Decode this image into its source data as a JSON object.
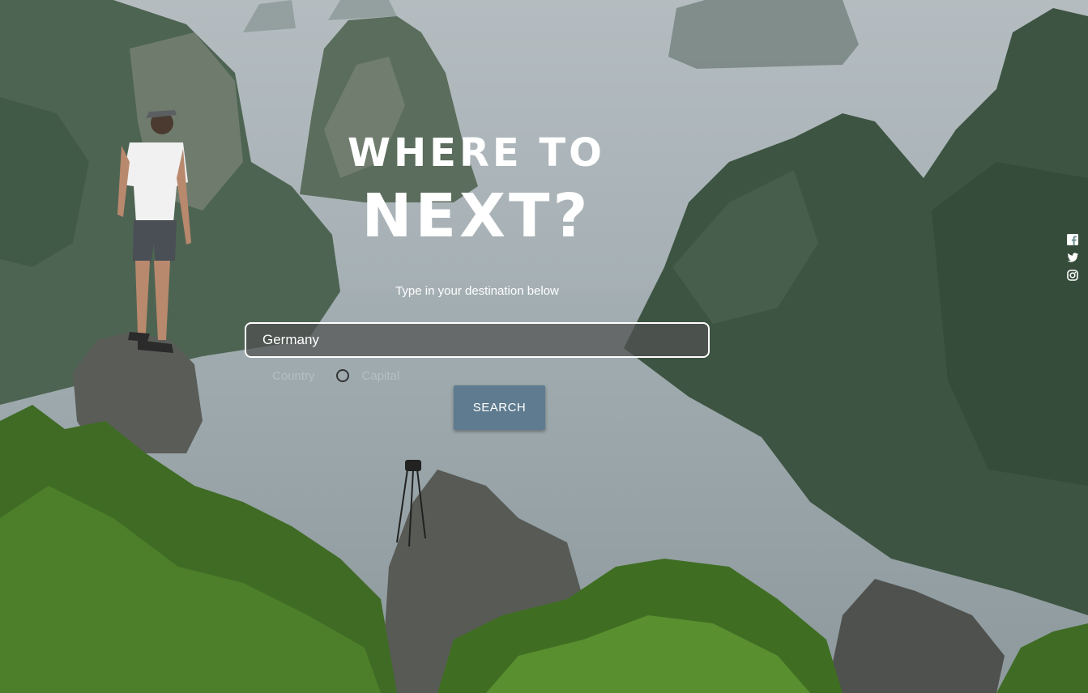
{
  "hero": {
    "title_top": "WHERE TO",
    "title_main": "NEXT?",
    "subtitle": "Type in your destination below"
  },
  "search": {
    "value": "Germany",
    "button_label": "SEARCH",
    "options": [
      {
        "label": "Country",
        "selected": true
      },
      {
        "label": "Capital",
        "selected": false
      }
    ]
  },
  "social": {
    "icons": [
      "facebook-icon",
      "twitter-icon",
      "instagram-icon"
    ]
  },
  "colors": {
    "button_bg": "#5e7b8f",
    "text": "#ffffff",
    "input_bg": "rgba(80,80,80,0.72)"
  }
}
